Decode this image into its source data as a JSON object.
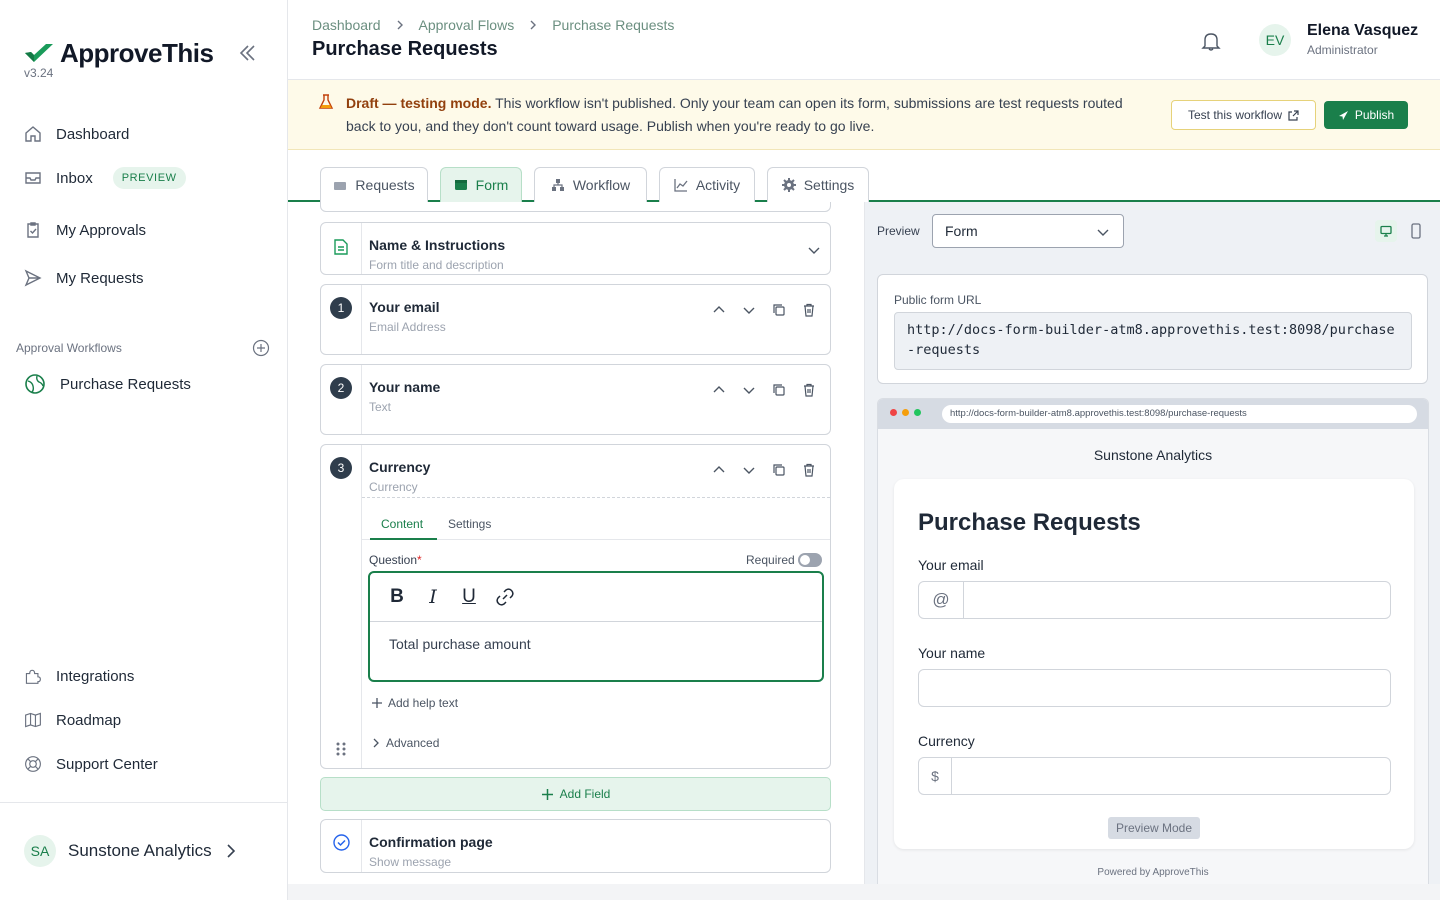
{
  "app": {
    "name": "ApproveThis",
    "version": "v3.24",
    "brand_color": "#1a7f4b"
  },
  "sidebar": {
    "nav": [
      {
        "label": "Dashboard",
        "icon": "home-icon"
      },
      {
        "label": "Inbox",
        "icon": "inbox-icon",
        "badge": "PREVIEW"
      },
      {
        "label": "My Approvals",
        "icon": "clipboard-check-icon"
      },
      {
        "label": "My Requests",
        "icon": "send-icon"
      }
    ],
    "workflows_section_label": "Approval Workflows",
    "workflows": [
      {
        "label": "Purchase Requests",
        "icon": "globe-icon"
      }
    ],
    "bottom_nav": [
      {
        "label": "Integrations",
        "icon": "puzzle-icon"
      },
      {
        "label": "Roadmap",
        "icon": "map-icon"
      },
      {
        "label": "Support Center",
        "icon": "lifebuoy-icon"
      }
    ],
    "org": {
      "initials": "SA",
      "name": "Sunstone Analytics"
    }
  },
  "header": {
    "breadcrumb": [
      "Dashboard",
      "Approval Flows",
      "Purchase Requests"
    ],
    "title": "Purchase Requests",
    "user": {
      "initials": "EV",
      "name": "Elena Vasquez",
      "role": "Administrator"
    }
  },
  "banner": {
    "strong": "Draft — testing mode.",
    "text": " This workflow isn't published. Only your team can open its form, submissions are test requests routed back to you, and they don't count toward usage. Publish when you're ready to go live.",
    "test_button": "Test this workflow",
    "publish_button": "Publish"
  },
  "tabs": [
    {
      "label": "Requests",
      "icon": "inbox-tray-icon"
    },
    {
      "label": "Form",
      "icon": "form-icon",
      "active": true
    },
    {
      "label": "Workflow",
      "icon": "hierarchy-icon"
    },
    {
      "label": "Activity",
      "icon": "chart-line-icon"
    },
    {
      "label": "Settings",
      "icon": "gear-icon"
    }
  ],
  "builder": {
    "name_card": {
      "title": "Name & Instructions",
      "subtitle": "Form title and description"
    },
    "fields": [
      {
        "number": "1",
        "title": "Your email",
        "type": "Email Address"
      },
      {
        "number": "2",
        "title": "Your name",
        "type": "Text"
      },
      {
        "number": "3",
        "title": "Currency",
        "type": "Currency"
      }
    ],
    "sub_tabs": [
      "Content",
      "Settings"
    ],
    "question_label": "Question",
    "required_asterisk": "*",
    "required_label": "Required",
    "question_text": "Total purchase amount",
    "add_help_text": "Add help text",
    "advanced": "Advanced",
    "add_field": "Add Field",
    "confirmation": {
      "title": "Confirmation page",
      "subtitle": "Show message"
    }
  },
  "preview": {
    "label": "Preview",
    "select_value": "Form",
    "public_url_label": "Public form URL",
    "public_url": "http://docs-form-builder-atm8.approvethis.test:8098/purchase-requests",
    "browser_url": "http://docs-form-builder-atm8.approvethis.test:8098/purchase-requests",
    "org_name": "Sunstone Analytics",
    "form_title": "Purchase Requests",
    "fields": [
      {
        "label": "Your email",
        "addon": "@"
      },
      {
        "label": "Your name",
        "addon": ""
      },
      {
        "label": "Currency",
        "addon": "$"
      }
    ],
    "preview_mode": "Preview Mode",
    "powered_by": "Powered by ApproveThis"
  }
}
